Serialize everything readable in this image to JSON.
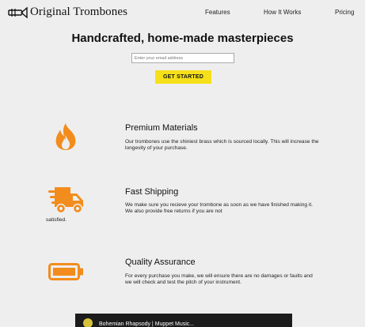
{
  "header": {
    "brand": "Original Trombones",
    "logo_icon": "trombone-logo-icon",
    "nav": [
      "Features",
      "How It Works",
      "Pricing"
    ]
  },
  "hero": {
    "title": "Handcrafted, home-made masterpieces",
    "email_placeholder": "Enter your email address",
    "cta_label": "GET STARTED"
  },
  "features": [
    {
      "icon": "flame-icon",
      "title": "Premium Materials",
      "description": "Our trombones use the shiniest brass which is sourced locally. This will increase the longevity of your purchase."
    },
    {
      "icon": "shipping-truck-icon",
      "title": "Fast Shipping",
      "description": "We make sure you recieve your trombone as soon as we have finished making it. We also provide free returns if you are not",
      "overflow_text": "satisfied."
    },
    {
      "icon": "battery-icon",
      "title": "Quality Assurance",
      "description": "For every purchase you make, we will ensure there are no damages or faults and we will check and test the pitch of your instrument."
    }
  ],
  "video": {
    "title": "Bohemian Rhapsody | Muppet Music..."
  },
  "colors": {
    "accent_icon": "#f28c1c",
    "cta_background": "#f5e01a",
    "page_background": "#eeeeee"
  }
}
